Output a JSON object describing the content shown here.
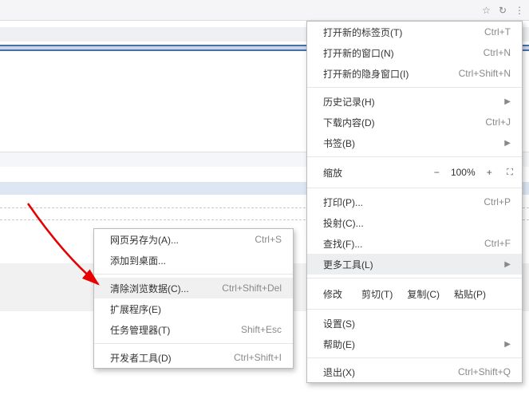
{
  "toolbar": {
    "star": "star-icon",
    "reload": "reload-icon",
    "menu": "menu-icon"
  },
  "mainmenu": {
    "new_tab": {
      "label": "打开新的标签页(T)",
      "shortcut": "Ctrl+T"
    },
    "new_window": {
      "label": "打开新的窗口(N)",
      "shortcut": "Ctrl+N"
    },
    "new_incognito": {
      "label": "打开新的隐身窗口(I)",
      "shortcut": "Ctrl+Shift+N"
    },
    "history": {
      "label": "历史记录(H)"
    },
    "downloads": {
      "label": "下载内容(D)",
      "shortcut": "Ctrl+J"
    },
    "bookmarks": {
      "label": "书签(B)"
    },
    "zoom": {
      "label": "缩放",
      "minus": "−",
      "value": "100%",
      "plus": "+",
      "fullscreen": "⤢"
    },
    "print": {
      "label": "打印(P)...",
      "shortcut": "Ctrl+P"
    },
    "cast": {
      "label": "投射(C)..."
    },
    "find": {
      "label": "查找(F)...",
      "shortcut": "Ctrl+F"
    },
    "more_tools": {
      "label": "更多工具(L)"
    },
    "edit": {
      "label": "修改",
      "cut": "剪切(T)",
      "copy": "复制(C)",
      "paste": "粘贴(P)"
    },
    "settings": {
      "label": "设置(S)"
    },
    "help": {
      "label": "帮助(E)"
    },
    "exit": {
      "label": "退出(X)",
      "shortcut": "Ctrl+Shift+Q"
    }
  },
  "submenu": {
    "save_as": {
      "label": "网页另存为(A)...",
      "shortcut": "Ctrl+S"
    },
    "add_to_desktop": {
      "label": "添加到桌面..."
    },
    "clear_data": {
      "label": "清除浏览数据(C)...",
      "shortcut": "Ctrl+Shift+Del"
    },
    "extensions": {
      "label": "扩展程序(E)"
    },
    "task_manager": {
      "label": "任务管理器(T)",
      "shortcut": "Shift+Esc"
    },
    "dev_tools": {
      "label": "开发者工具(D)",
      "shortcut": "Ctrl+Shift+I"
    }
  },
  "annotation": {
    "arrow_target": "clear_data"
  }
}
